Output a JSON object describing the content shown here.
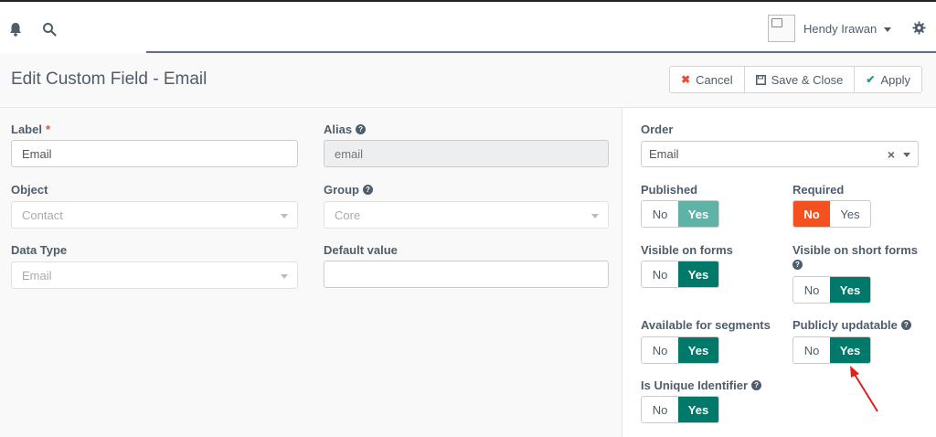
{
  "topbar": {
    "username": "Hendy Irawan"
  },
  "header": {
    "title": "Edit Custom Field - Email",
    "cancel_label": "Cancel",
    "save_close_label": "Save & Close",
    "apply_label": "Apply"
  },
  "form": {
    "label": {
      "label": "Label",
      "required_mark": "*",
      "value": "Email"
    },
    "alias": {
      "label": "Alias",
      "value": "email"
    },
    "object": {
      "label": "Object",
      "value": "Contact"
    },
    "group": {
      "label": "Group",
      "value": "Core"
    },
    "data_type": {
      "label": "Data Type",
      "value": "Email"
    },
    "default_value": {
      "label": "Default value",
      "value": ""
    }
  },
  "sidebar": {
    "order": {
      "label": "Order",
      "value": "Email"
    },
    "published": {
      "label": "Published",
      "no": "No",
      "yes": "Yes",
      "selected": "Yes"
    },
    "required": {
      "label": "Required",
      "no": "No",
      "yes": "Yes",
      "selected": "No"
    },
    "visible_on_forms": {
      "label": "Visible on forms",
      "no": "No",
      "yes": "Yes",
      "selected": "Yes"
    },
    "visible_on_short_forms": {
      "label": "Visible on short forms",
      "no": "No",
      "yes": "Yes",
      "selected": "Yes"
    },
    "available_for_segments": {
      "label": "Available for segments",
      "no": "No",
      "yes": "Yes",
      "selected": "Yes"
    },
    "publicly_updatable": {
      "label": "Publicly updatable",
      "no": "No",
      "yes": "Yes",
      "selected": "Yes"
    },
    "is_unique_identifier": {
      "label": "Is Unique Identifier",
      "no": "No",
      "yes": "Yes",
      "selected": "Yes"
    }
  },
  "colors": {
    "yes_active": "#00786a",
    "yes_light": "#5fb2a6",
    "no_active": "#f4511e",
    "annotation_arrow": "#e0201a"
  }
}
